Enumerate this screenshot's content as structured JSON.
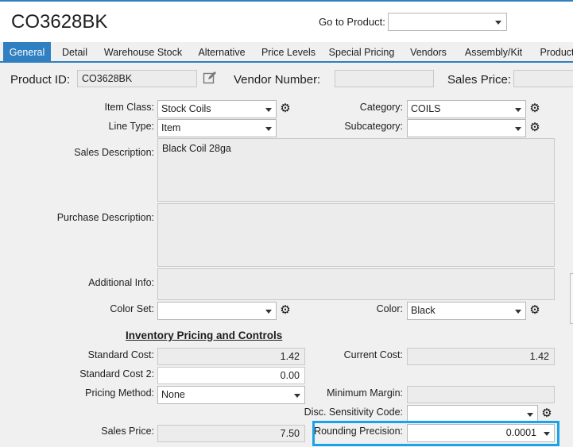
{
  "header": {
    "title": "CO3628BK",
    "goto_label": "Go to Product:",
    "goto_value": ""
  },
  "tabs": [
    {
      "label": "General",
      "active": true
    },
    {
      "label": "Detail"
    },
    {
      "label": "Warehouse Stock"
    },
    {
      "label": "Alternative"
    },
    {
      "label": "Price Levels"
    },
    {
      "label": "Special Pricing"
    },
    {
      "label": "Vendors"
    },
    {
      "label": "Assembly/Kit"
    },
    {
      "label": "Product"
    }
  ],
  "general": {
    "product_id_label": "Product ID:",
    "product_id": "CO3628BK",
    "vendor_number_label": "Vendor Number:",
    "vendor_number": "",
    "sales_price_label": "Sales Price:",
    "sales_price": "",
    "item_class_label": "Item Class:",
    "item_class": "Stock Coils",
    "category_label": "Category:",
    "category": "COILS",
    "line_type_label": "Line Type:",
    "line_type": "Item",
    "subcategory_label": "Subcategory:",
    "subcategory": "",
    "sales_description_label": "Sales Description:",
    "sales_description": "Black Coil 28ga",
    "purchase_description_label": "Purchase Description:",
    "purchase_description": "",
    "additional_info_label": "Additional Info:",
    "additional_info": "",
    "color_set_label": "Color Set:",
    "color_set": "",
    "color_label": "Color:",
    "color": "Black"
  },
  "inventory": {
    "section_title": "Inventory Pricing and Controls",
    "standard_cost_label": "Standard Cost:",
    "standard_cost": "1.42",
    "current_cost_label": "Current Cost:",
    "current_cost": "1.42",
    "standard_cost2_label": "Standard Cost 2:",
    "standard_cost2": "0.00",
    "pricing_method_label": "Pricing Method:",
    "pricing_method": "None",
    "minimum_margin_label": "Minimum Margin:",
    "minimum_margin": "",
    "disc_sensitivity_label": "Disc. Sensitivity Code:",
    "disc_sensitivity": "",
    "sales_price_label": "Sales Price:",
    "sales_price": "7.50",
    "rounding_precision_label": "Rounding Precision:",
    "rounding_precision": "0.0001"
  },
  "colors": {
    "accent": "#2f7fc1",
    "highlight": "#1aa3e8"
  }
}
